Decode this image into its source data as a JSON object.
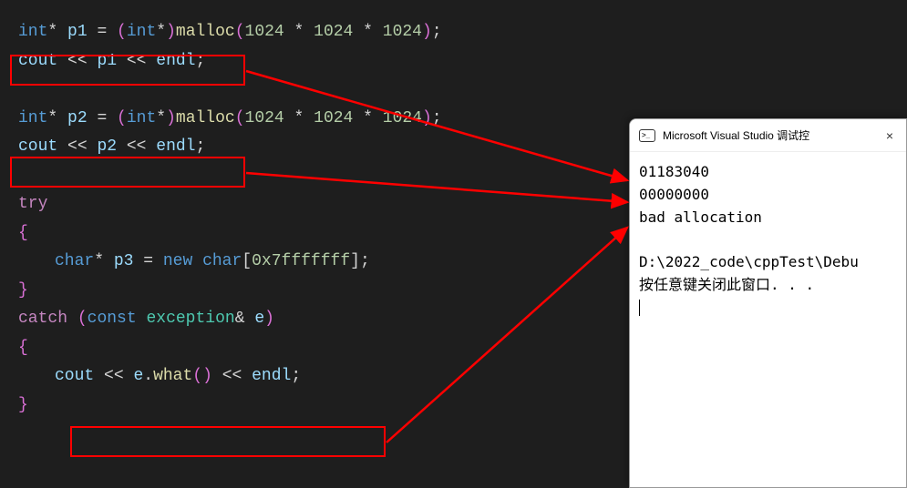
{
  "code": {
    "line1": {
      "type": "int",
      "ptr": "*",
      "var": "p1",
      "eq": " = ",
      "cast_open": "(",
      "cast_type": "int",
      "cast_ptr": "*",
      "cast_close": ")",
      "func": "malloc",
      "args_open": "(",
      "n1": "1024",
      "mul1": " * ",
      "n2": "1024",
      "mul2": " * ",
      "n3": "1024",
      "args_close": ")",
      "semi": ";"
    },
    "line2": {
      "cout": "cout",
      "lshift1": " << ",
      "var": "p1",
      "lshift2": " << ",
      "endl": "endl",
      "semi": ";"
    },
    "line4": {
      "type": "int",
      "ptr": "*",
      "var": "p2",
      "eq": " = ",
      "cast_open": "(",
      "cast_type": "int",
      "cast_ptr": "*",
      "cast_close": ")",
      "func": "malloc",
      "args_open": "(",
      "n1": "1024",
      "mul1": " * ",
      "n2": "1024",
      "mul2": " * ",
      "n3": "1024",
      "args_close": ")",
      "semi": ";"
    },
    "line5": {
      "cout": "cout",
      "lshift1": " << ",
      "var": "p2",
      "lshift2": " << ",
      "endl": "endl",
      "semi": ";"
    },
    "line7": {
      "try": "try"
    },
    "line8": {
      "brace": "{"
    },
    "line9": {
      "type": "char",
      "ptr": "*",
      "var": "p3",
      "eq": " = ",
      "new": "new",
      "sp": " ",
      "arrtype": "char",
      "br_open": "[",
      "hex": "0x7fffffff",
      "br_close": "]",
      "semi": ";"
    },
    "line10": {
      "brace": "}"
    },
    "line11": {
      "catch": "catch",
      "sp": " ",
      "paren_open": "(",
      "const": "const",
      "sp2": " ",
      "exc": "exception",
      "amp": "&",
      "sp3": " ",
      "e": "e",
      "paren_close": ")"
    },
    "line12": {
      "brace": "{"
    },
    "line13": {
      "cout": "cout",
      "lshift1": " << ",
      "e": "e",
      "dot": ".",
      "what": "what",
      "paren_open": "(",
      "paren_close": ")",
      "lshift2": " << ",
      "endl": "endl",
      "semi": ";"
    },
    "line14": {
      "brace": "}"
    }
  },
  "console": {
    "title": "Microsoft Visual Studio 调试控",
    "close": "×",
    "out1": "01183040",
    "out2": "00000000",
    "out3": "bad allocation",
    "blank": "",
    "out4": "D:\\2022_code\\cppTest\\Debu",
    "out5": "按任意键关闭此窗口. . ."
  },
  "colors": {
    "arrow": "#ff0000",
    "bg": "#1e1e1e"
  }
}
